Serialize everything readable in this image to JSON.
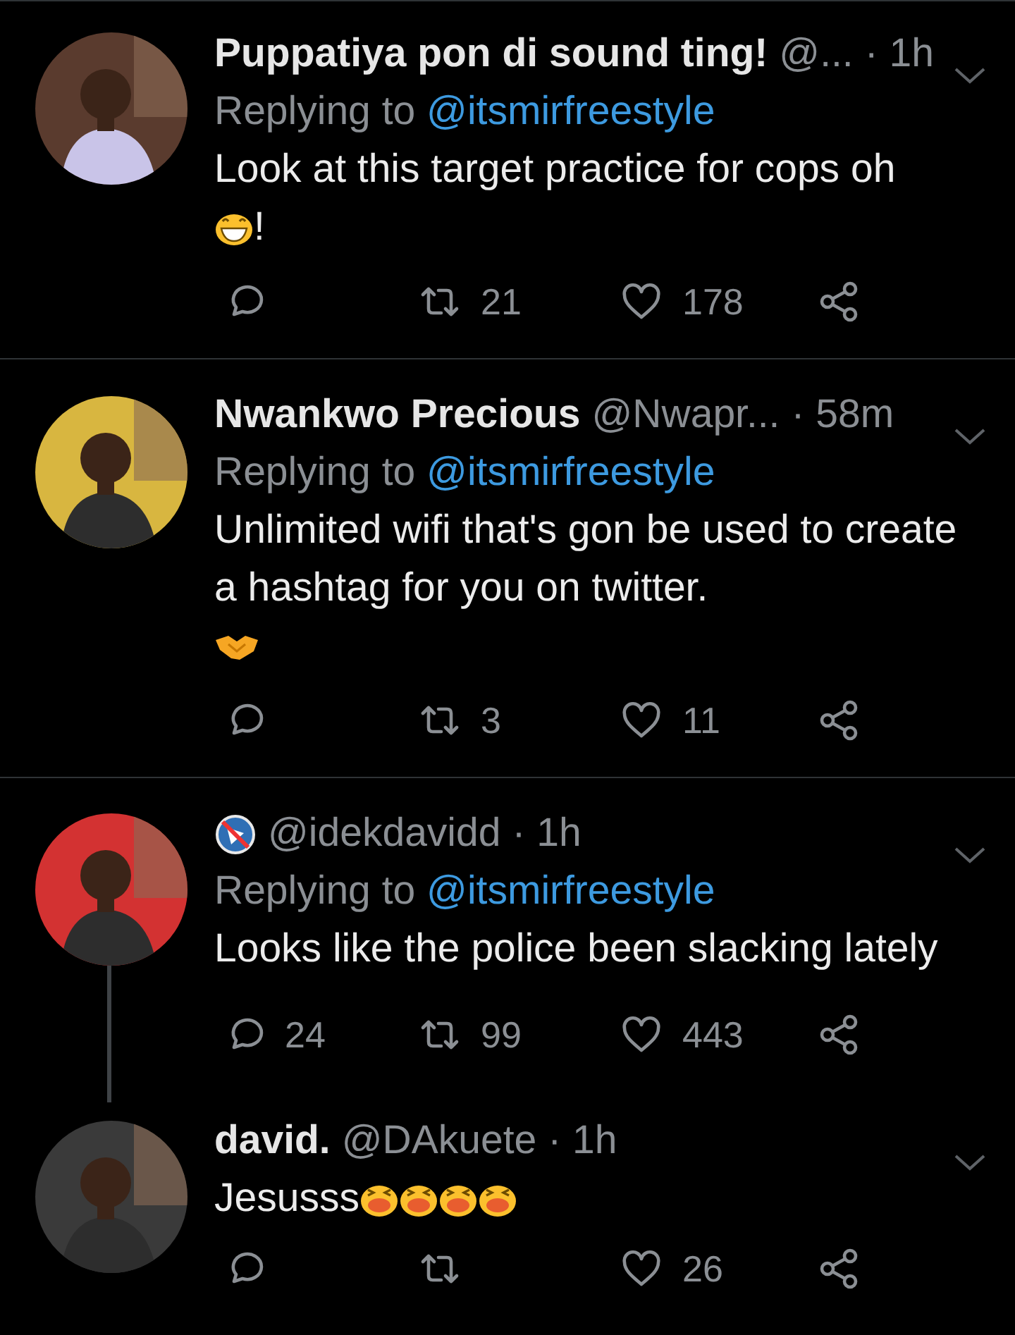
{
  "tweets": [
    {
      "name": "Puppatiya pon di sound ting!",
      "handle": "@...",
      "time": "· 1h",
      "reply_label": "Replying to",
      "reply_to": "@itsmirfreestyle",
      "text": "Look at this target practice for cops oh",
      "emojis": [
        {
          "kind": "grin"
        }
      ],
      "text_after": "!",
      "retweets": "21",
      "likes": "178",
      "divider_below": true
    },
    {
      "name": "Nwankwo Precious",
      "handle": "@Nwapr...",
      "time": "· 58m",
      "reply_label": "Replying to",
      "reply_to": "@itsmirfreestyle",
      "text": "Unlimited wifi that's gon be used to create a hashtag for you on twitter.",
      "emojis": [
        {
          "kind": "handshake"
        }
      ],
      "retweets": "3",
      "likes": "11",
      "divider_below": true
    },
    {
      "handle": "@idekdavidd",
      "time": "· 1h",
      "label_icon": true,
      "reply_label": "Replying to",
      "reply_to": "@itsmirfreestyle",
      "text": "Looks like the police been slacking lately",
      "replies": "24",
      "retweets": "99",
      "likes": "443",
      "thread_below": true
    },
    {
      "name": "david.",
      "handle": "@DAkuete",
      "time": "· 1h",
      "text": "Jesusss",
      "emojis": [
        {
          "kind": "tired"
        },
        {
          "kind": "tired"
        },
        {
          "kind": "tired"
        },
        {
          "kind": "tired"
        }
      ],
      "likes": "26"
    }
  ]
}
